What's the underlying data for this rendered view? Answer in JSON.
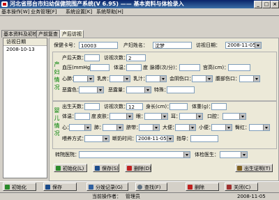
{
  "window": {
    "title": "河北省邢台市妇幼保健院围产系统(V 6.95) —— 基本资料与体检录入"
  },
  "menubar": {
    "items": [
      "基本操作[W]",
      "业务管理[F]",
      "系统设置[K]",
      "系统帮助[H]"
    ]
  },
  "tabs": [
    "基本资料及初检",
    "产前复查",
    "产后访视"
  ],
  "visit_list": {
    "header": "访视日期",
    "rows": [
      "2008-10-13"
    ]
  },
  "form": {
    "card_label": "保健卡号：",
    "card_value": "10003",
    "name_label": "产妇姓名：",
    "name_value": "沈梦",
    "visit_date_label": "访视日期：",
    "visit_date_value": "2008-11-05",
    "mother_group": "产妇情况",
    "postpartum_days": "产后天数：",
    "visit_count": "访视次数：",
    "visit_count_value": "2",
    "blood_pressure": "血压(mmHg)：",
    "temperature": "体温：",
    "temp_unit": "度",
    "pulse": "脉搏(次/分)：",
    "uterus_height": "宫高(cm)：",
    "heart": "心肺：",
    "breast": "乳房：",
    "milk": "乳汁：",
    "perineum": "会阴伤口：",
    "abdomen": "腹部伤口：",
    "lochia_color": "恶露色：",
    "lochia_amount": "恶露量：",
    "special": "特殊：",
    "baby_group": "婴儿情况",
    "birth_days": "出生天数：",
    "baby_visit_count": "访视次数：",
    "baby_visit_count_value": "12",
    "length": "身长(cm)：",
    "weight": "体重(g)：",
    "baby_temp": "体温：",
    "baby_temp_unit": "度",
    "skin": "皮肤：",
    "eyes": "眼：",
    "ears": "耳：",
    "mouth": "口腔：",
    "heart2": "心：",
    "lung": "肺：",
    "navel": "脐带：",
    "stool": "大便：",
    "urine": "小便：",
    "hip": "臀红：",
    "feeding": "喂养方式：",
    "visit_time": "断奶时间：",
    "visit_time_value": "2008-11-05",
    "guide": "指导：",
    "transfer": "转院医院：",
    "doctor": "体检医生："
  },
  "form_buttons": {
    "init": "初始化(L)",
    "save": "保存(S)",
    "delete": "删除(D)",
    "birth_cert": "出生证明(T)"
  },
  "toolbar": {
    "init": "初始化",
    "save": "保存",
    "records": "分娩记录(G)",
    "search": "查找(F)",
    "delete": "删除",
    "close": "关闭(C)"
  },
  "status": {
    "operator_label": "当前操作者：",
    "operator": "管理员",
    "date": "2008-11-05"
  },
  "colors": {
    "accent": "#0a246a",
    "group_text": "#008000"
  }
}
